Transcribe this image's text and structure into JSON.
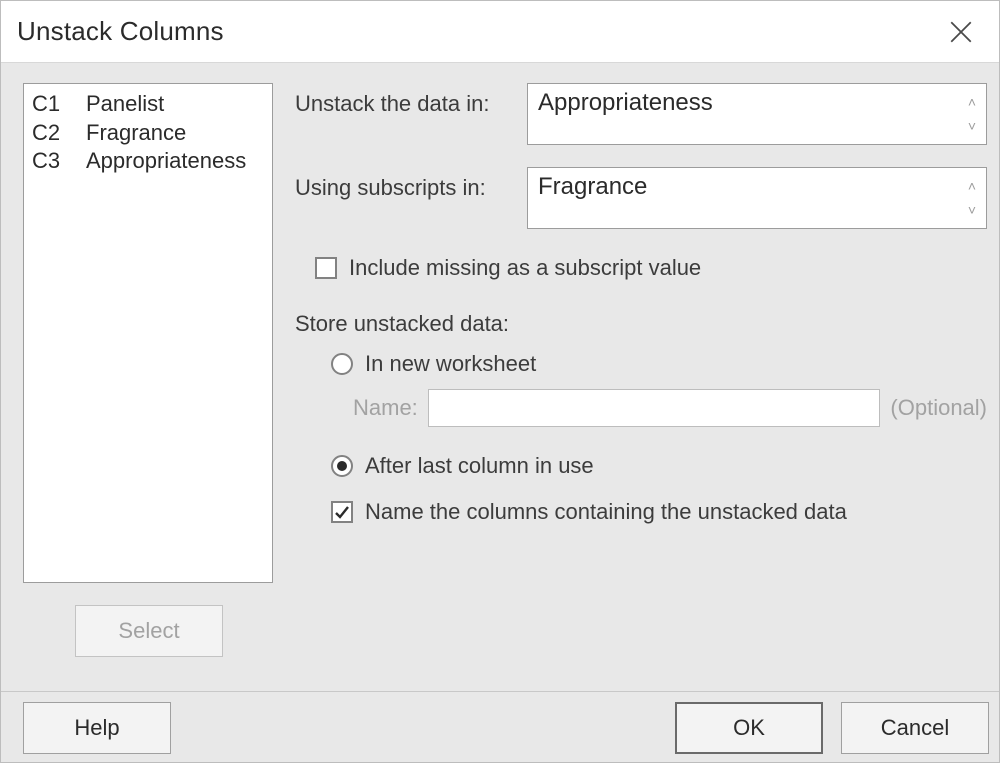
{
  "title": "Unstack Columns",
  "columns": [
    {
      "id": "C1",
      "name": "Panelist"
    },
    {
      "id": "C2",
      "name": "Fragrance"
    },
    {
      "id": "C3",
      "name": "Appropriateness"
    }
  ],
  "buttons": {
    "select": "Select",
    "help": "Help",
    "ok": "OK",
    "cancel": "Cancel"
  },
  "labels": {
    "unstack": "Unstack the data in:",
    "subscripts": "Using subscripts in:",
    "include_missing": "Include missing as a subscript value",
    "store": "Store unstacked data:",
    "in_new": "In new worksheet",
    "name": "Name:",
    "optional": "(Optional)",
    "after_last": "After last column in use",
    "name_cols": "Name the columns containing the unstacked data"
  },
  "fields": {
    "unstack_value": "Appropriateness",
    "subscripts_value": "Fragrance",
    "new_worksheet_name": ""
  },
  "state": {
    "include_missing_checked": false,
    "store_in_new_worksheet": false,
    "store_after_last": true,
    "name_cols_checked": true
  }
}
